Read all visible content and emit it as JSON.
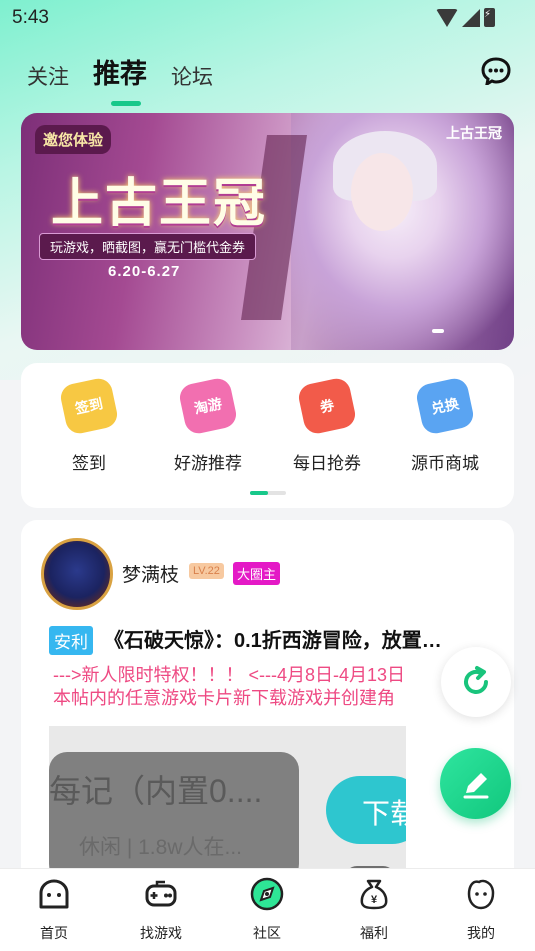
{
  "status_bar": {
    "time": "5:43"
  },
  "header": {
    "tabs": [
      {
        "label": "关注",
        "active": false
      },
      {
        "label": "推荐",
        "active": true
      },
      {
        "label": "论坛",
        "active": false
      }
    ],
    "chat_icon": "chat-bubble-icon"
  },
  "banner": {
    "badge": "邀您体验",
    "title": "上古王冠",
    "subtitle": "玩游戏，晒截图，赢无门槛代金券",
    "date": "6.20-6.27",
    "logo": "上古王冠"
  },
  "quick_menu": [
    {
      "label": "签到",
      "icon_text": "签到",
      "icon": "checkin-icon",
      "color": "#f7c843"
    },
    {
      "label": "好游推荐",
      "icon_text": "淘游",
      "icon": "recommend-icon",
      "color": "#f26fb0"
    },
    {
      "label": "每日抢券",
      "icon_text": "券",
      "icon": "coupon-icon",
      "color": "#f25b4a"
    },
    {
      "label": "源币商城",
      "icon_text": "兑换",
      "icon": "shop-icon",
      "color": "#5aa4f2"
    }
  ],
  "post": {
    "username": "梦满枝",
    "level": "LV.22",
    "role": "大圈主",
    "tag": "安利",
    "title": "《石破天惊》：0.1折西游冒险，放置…",
    "text_line1": "--->新人限时特权！！！ <---4月8日-4月13日",
    "text_line2": "本帖内的任意游戏卡片新下载游戏并创建角",
    "image": {
      "title_fragment": "每记（内置0....",
      "meta_fragment": "休闲 | 1.8w人在...",
      "button_fragment": "下载"
    }
  },
  "bottom_nav": [
    {
      "label": "首页",
      "icon": "home-icon"
    },
    {
      "label": "找游戏",
      "icon": "gamepad-icon"
    },
    {
      "label": "社区",
      "icon": "community-icon"
    },
    {
      "label": "福利",
      "icon": "money-bag-icon"
    },
    {
      "label": "我的",
      "icon": "profile-face-icon"
    }
  ],
  "accent_color": "#17c88a"
}
